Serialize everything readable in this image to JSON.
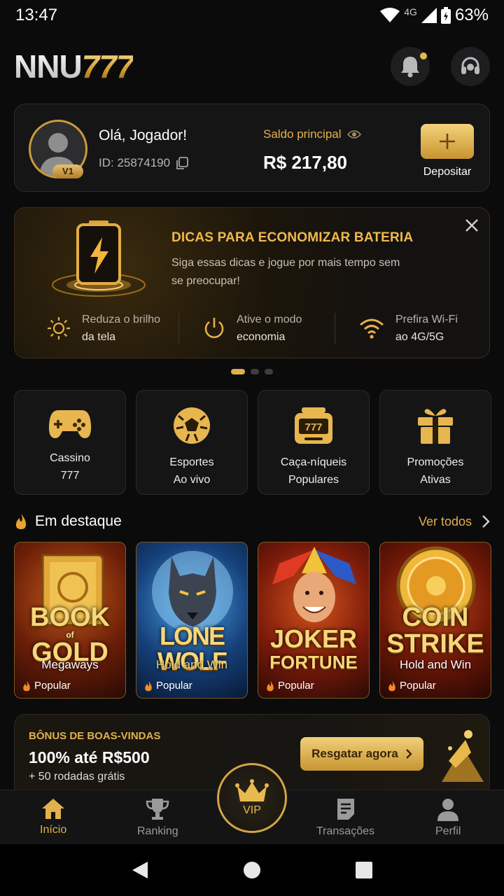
{
  "status": {
    "time": "13:47",
    "network": "4G",
    "battery": "63%"
  },
  "header": {
    "logo_a": "NNU",
    "logo_b": "777",
    "icons": [
      "bell-icon",
      "headset-icon"
    ]
  },
  "account": {
    "greeting": "Olá, Jogador!",
    "id_label": "ID: 25874190",
    "vip_badge": "V1",
    "balance_label": "Saldo principal",
    "balance_value": "R$ 217,80",
    "deposit_label": "Depositar"
  },
  "tips": {
    "title": "DICAS PARA ECONOMIZAR BATERIA",
    "text": "Siga essas dicas e jogue por mais tempo sem se preocupar!",
    "items": [
      {
        "line1": "Reduza o brilho",
        "line2": "da tela",
        "icon": "sun-icon"
      },
      {
        "line1": "Ative o modo",
        "line2": "economia",
        "icon": "power-icon"
      },
      {
        "line1": "Prefira Wi-Fi",
        "line2": "ao 4G/5G",
        "icon": "wifi-icon"
      }
    ]
  },
  "categories": [
    {
      "line1": "Cassino",
      "line2": "777",
      "icon": "gamepad-icon"
    },
    {
      "line1": "Esportes",
      "line2": "Ao vivo",
      "icon": "soccer-ball-icon"
    },
    {
      "line1": "Caça-níqueis",
      "line2": "Populares",
      "icon": "slot-machine-icon"
    },
    {
      "line1": "Promoções",
      "line2": "Ativas",
      "icon": "gift-icon"
    }
  ],
  "featured": {
    "title": "Em destaque",
    "see_all": "Ver todos"
  },
  "games": [
    {
      "title1": "BOOK",
      "title2": "GOLD",
      "of": "of",
      "subtitle": "Megaways",
      "tag": "Popular"
    },
    {
      "title1": "LONE WOLF",
      "subtitle": "Hold and Win",
      "tag": "Popular"
    },
    {
      "title1": "JOKER",
      "title2": "FORTUNE",
      "tag": "Popular"
    },
    {
      "title1": "COIN",
      "title2": "STRIKE",
      "subtitle": "Hold and Win",
      "tag": "Popular"
    }
  ],
  "bonus": {
    "kicker": "BÔNUS DE BOAS-VINDAS",
    "headline": "100% até R$500",
    "sub": "+ 50 rodadas grátis",
    "cta": "Resgatar agora"
  },
  "nav": {
    "home": "Início",
    "ranking": "Ranking",
    "vip": "VIP",
    "transactions": "Transações",
    "profile": "Perfil"
  },
  "colors": {
    "accent": "#e2b04c",
    "background": "#0b0b0c",
    "card": "#151516"
  }
}
